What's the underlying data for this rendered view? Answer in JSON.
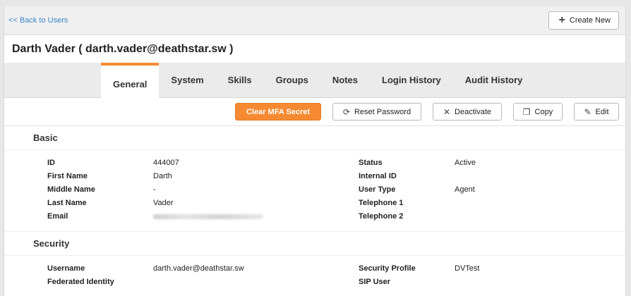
{
  "topbar": {
    "back_label": "<< Back to Users",
    "create_label": "Create New",
    "create_icon": "plus-icon"
  },
  "user": {
    "title": "Darth Vader ( darth.vader@deathstar.sw )"
  },
  "tabs": [
    {
      "label": "General",
      "active": true
    },
    {
      "label": "System"
    },
    {
      "label": "Skills"
    },
    {
      "label": "Groups"
    },
    {
      "label": "Notes"
    },
    {
      "label": "Login History"
    },
    {
      "label": "Audit History"
    }
  ],
  "actions": {
    "clear_mfa": "Clear MFA Secret",
    "reset_password": "Reset Password",
    "deactivate": "Deactivate",
    "copy": "Copy",
    "edit": "Edit"
  },
  "basic": {
    "title": "Basic",
    "id_label": "ID",
    "id_value": "444007",
    "first_name_label": "First Name",
    "first_name_value": "Darth",
    "middle_name_label": "Middle Name",
    "middle_name_value": "-",
    "last_name_label": "Last Name",
    "last_name_value": "Vader",
    "email_label": "Email",
    "status_label": "Status",
    "status_value": "Active",
    "internal_id_label": "Internal ID",
    "user_type_label": "User Type",
    "user_type_value": "Agent",
    "telephone1_label": "Telephone 1",
    "telephone2_label": "Telephone 2"
  },
  "security": {
    "title": "Security",
    "username_label": "Username",
    "username_value": "darth.vader@deathstar.sw",
    "federated_label": "Federated Identity",
    "security_profile_label": "Security Profile",
    "security_profile_value": "DVTest",
    "sip_user_label": "SIP User"
  },
  "colors": {
    "accent": "#f58a32",
    "link": "#3b86c9"
  }
}
